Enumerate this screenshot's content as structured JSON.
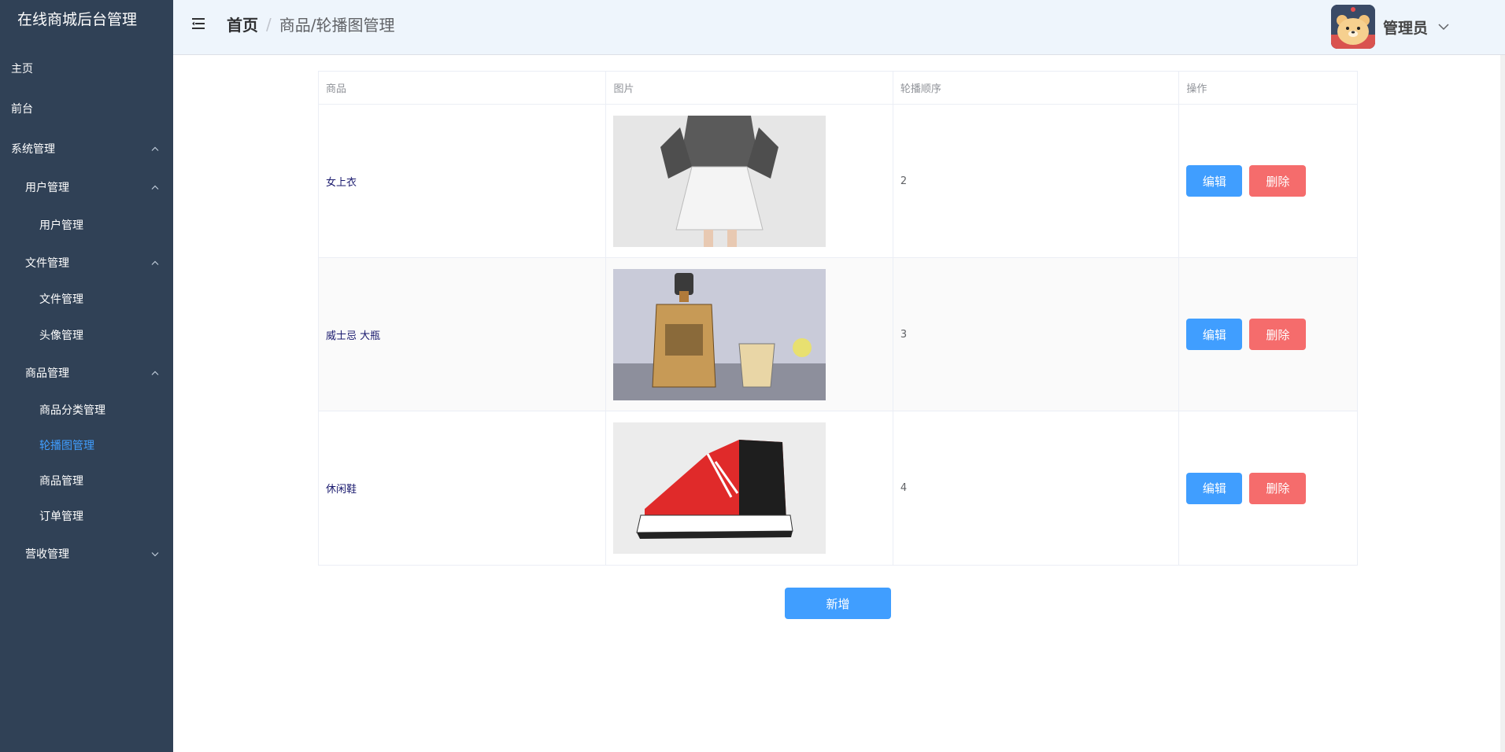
{
  "app": {
    "title": "在线商城后台管理"
  },
  "sidebar": {
    "items": [
      {
        "label": "主页",
        "level": 0,
        "chevron": ""
      },
      {
        "label": "前台",
        "level": 0,
        "chevron": ""
      },
      {
        "label": "系统管理",
        "level": 0,
        "chevron": "up"
      },
      {
        "label": "用户管理",
        "level": 1,
        "chevron": "up"
      },
      {
        "label": "用户管理",
        "level": 2,
        "chevron": ""
      },
      {
        "label": "文件管理",
        "level": 1,
        "chevron": "up"
      },
      {
        "label": "文件管理",
        "level": 2,
        "chevron": ""
      },
      {
        "label": "头像管理",
        "level": 2,
        "chevron": ""
      },
      {
        "label": "商品管理",
        "level": 1,
        "chevron": "up"
      },
      {
        "label": "商品分类管理",
        "level": 2,
        "chevron": ""
      },
      {
        "label": "轮播图管理",
        "level": 2,
        "chevron": "",
        "active": true
      },
      {
        "label": "商品管理",
        "level": 2,
        "chevron": ""
      },
      {
        "label": "订单管理",
        "level": 2,
        "chevron": ""
      },
      {
        "label": "营收管理",
        "level": 1,
        "chevron": "down"
      }
    ]
  },
  "header": {
    "breadcrumb_home": "首页",
    "breadcrumb_sep": "/",
    "breadcrumb_current": "商品/轮播图管理",
    "user_name": "管理员"
  },
  "table": {
    "columns": [
      "商品",
      "图片",
      "轮播顺序",
      "操作"
    ],
    "rows": [
      {
        "name": "女上衣",
        "image": "blouse-photo",
        "order": "2"
      },
      {
        "name": "威士忌 大瓶",
        "image": "whiskey-photo",
        "order": "3"
      },
      {
        "name": "休闲鞋",
        "image": "sneaker-photo",
        "order": "4"
      }
    ],
    "edit_label": "编辑",
    "delete_label": "删除"
  },
  "actions": {
    "add_label": "新增"
  },
  "colors": {
    "sidebar_bg": "#304156",
    "primary": "#409eff",
    "danger": "#f56c6c",
    "header_bg": "#eef5fc"
  }
}
